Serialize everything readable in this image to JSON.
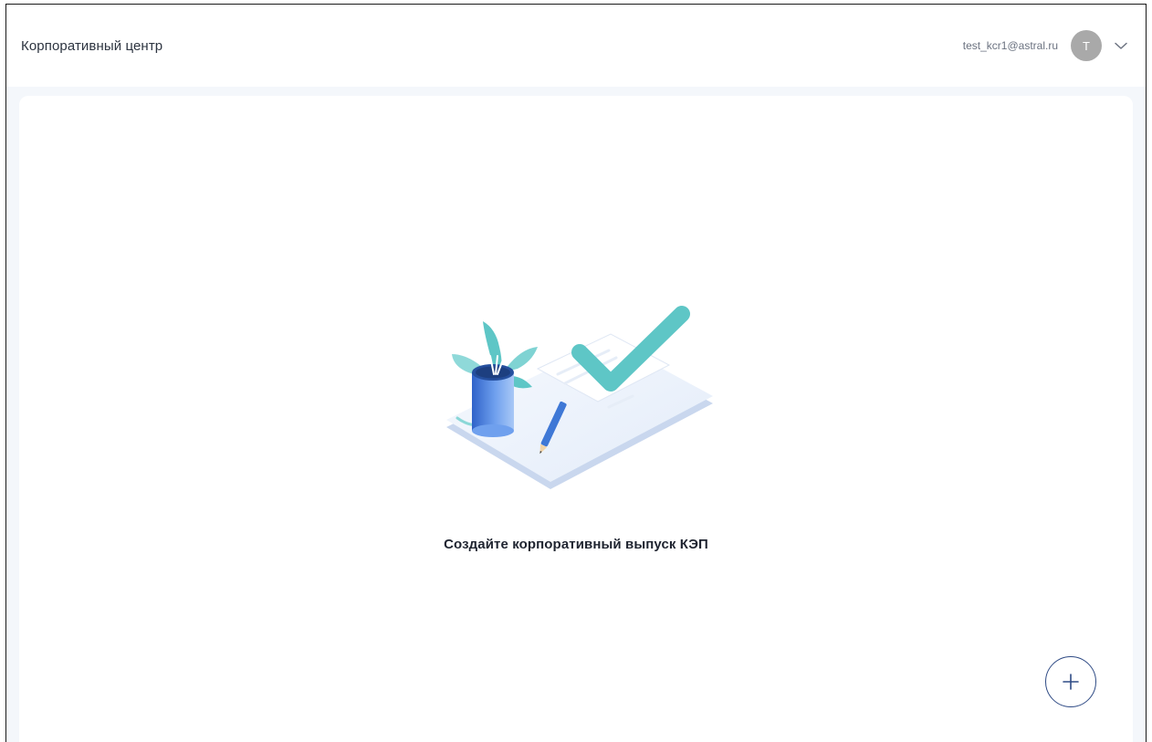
{
  "header": {
    "app_title": "Корпоративный центр",
    "user_email": "test_kcr1@astral.ru",
    "avatar_initial": "T",
    "menu_icon": "chevron-down-icon"
  },
  "main": {
    "empty_state": {
      "illustration": "document-checkmark-plant-illustration",
      "message": "Создайте корпоративный выпуск КЭП"
    },
    "add_button": {
      "icon": "plus-icon"
    }
  },
  "colors": {
    "page_background": "#f4f7fb",
    "panel_background": "#ffffff",
    "accent_teal": "#4ec3c3",
    "accent_blue": "#3f78d6",
    "add_button_border": "#2f4b85",
    "avatar": "#a9a9a9"
  }
}
